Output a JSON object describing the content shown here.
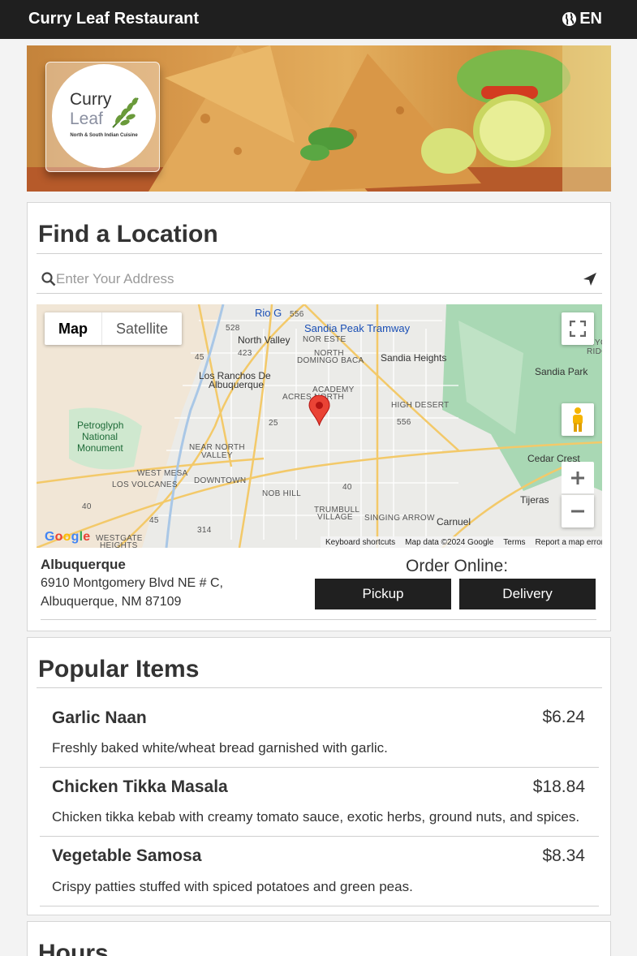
{
  "header": {
    "title": "Curry Leaf Restaurant",
    "lang_icon": "globe-icon",
    "lang": "EN"
  },
  "hero": {
    "logo_line1": "Curry",
    "logo_line2": "Leaf",
    "logo_tagline": "North & South Indian Cuisine"
  },
  "find_location": {
    "title": "Find a Location",
    "search_placeholder": "Enter Your Address",
    "search_value": "",
    "map": {
      "type_map": "Map",
      "type_satellite": "Satellite",
      "labels": {
        "north_valley": "North Valley",
        "los_ranchos": "Los Ranchos De",
        "los_ranchos2": "Albuquerque",
        "sandia_peak": "Sandia Peak Tramway",
        "sandia_heights": "Sandia Heights",
        "sandia_park": "Sandia Park",
        "nor_este": "NOR ESTE",
        "north_domingo": "NORTH",
        "north_domingo2": "DOMINGO BACA",
        "academy": "ACADEMY",
        "academy2": "ACRES NORTH",
        "high_desert": "HIGH DESERT",
        "petroglyph": "Petroglyph",
        "petroglyph2": "National",
        "petroglyph3": "Monument",
        "near_north": "NEAR NORTH",
        "near_north2": "VALLEY",
        "west_mesa": "WEST MESA",
        "los_volcanes": "LOS VOLCANES",
        "downtown": "DOWNTOWN",
        "nob_hill": "NOB HILL",
        "trumbull": "TRUMBULL",
        "trumbull2": "VILLAGE",
        "singing_arrow": "SINGING ARROW",
        "carnuel": "Carnuel",
        "tijeras": "Tijeras",
        "cedar_crest": "Cedar Crest",
        "westgate": "WESTGATE",
        "westgate2": "HEIGHTS",
        "rio_grande": "Rio G",
        "canyon": "CANYO",
        "ridge": "RIDGE EST",
        "hwy_556a": "556",
        "hwy_556b": "556",
        "hwy_528": "528",
        "hwy_423": "423",
        "hwy_45a": "45",
        "hwy_45b": "45",
        "hwy_314": "314",
        "i25": "25",
        "i40a": "40",
        "i40b": "40"
      },
      "google": "Google",
      "footer": {
        "shortcuts": "Keyboard shortcuts",
        "data": "Map data ©2024 Google",
        "terms": "Terms",
        "report": "Report a map error"
      }
    },
    "location": {
      "name": "Albuquerque",
      "address_line1": "6910 Montgomery Blvd NE # C,",
      "address_line2": "Albuquerque, NM 87109"
    },
    "order": {
      "label": "Order Online:",
      "pickup": "Pickup",
      "delivery": "Delivery"
    }
  },
  "popular": {
    "title": "Popular Items",
    "items": [
      {
        "name": "Garlic Naan",
        "price": "$6.24",
        "desc": "Freshly baked white/wheat bread garnished with garlic."
      },
      {
        "name": "Chicken Tikka Masala",
        "price": "$18.84",
        "desc": "Chicken tikka kebab with creamy tomato sauce, exotic herbs, ground nuts, and spices."
      },
      {
        "name": "Vegetable Samosa",
        "price": "$8.34",
        "desc": "Crispy patties stuffed with spiced potatoes and green peas."
      }
    ]
  },
  "hours": {
    "title": "Hours"
  }
}
